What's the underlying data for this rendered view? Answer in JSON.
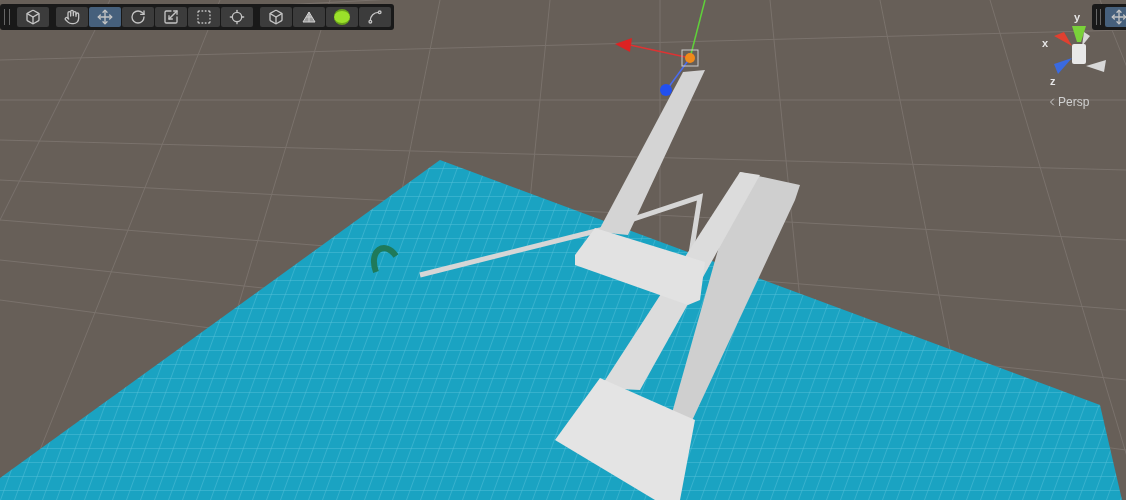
{
  "toolbar": {
    "groups": [
      {
        "tools": [
          {
            "kind": "view",
            "selected": false
          }
        ]
      },
      {
        "tools": [
          {
            "kind": "hand",
            "selected": false
          },
          {
            "kind": "move",
            "selected": true
          },
          {
            "kind": "rotate",
            "selected": false
          },
          {
            "kind": "scale",
            "selected": false
          },
          {
            "kind": "rect",
            "selected": false
          },
          {
            "kind": "transform",
            "selected": false
          }
        ]
      },
      {
        "tools": [
          {
            "kind": "draw-mode",
            "selected": false
          },
          {
            "kind": "shading",
            "selected": false
          },
          {
            "kind": "lighting",
            "selected": false
          },
          {
            "kind": "snap",
            "selected": false
          }
        ]
      }
    ]
  },
  "right_toolbar": {
    "tools": [
      {
        "kind": "move",
        "selected": true
      }
    ]
  },
  "orientation_gizmo": {
    "axes": [
      {
        "label": "y"
      },
      {
        "label": "x"
      },
      {
        "label": "z"
      }
    ],
    "projection": "Persp"
  }
}
